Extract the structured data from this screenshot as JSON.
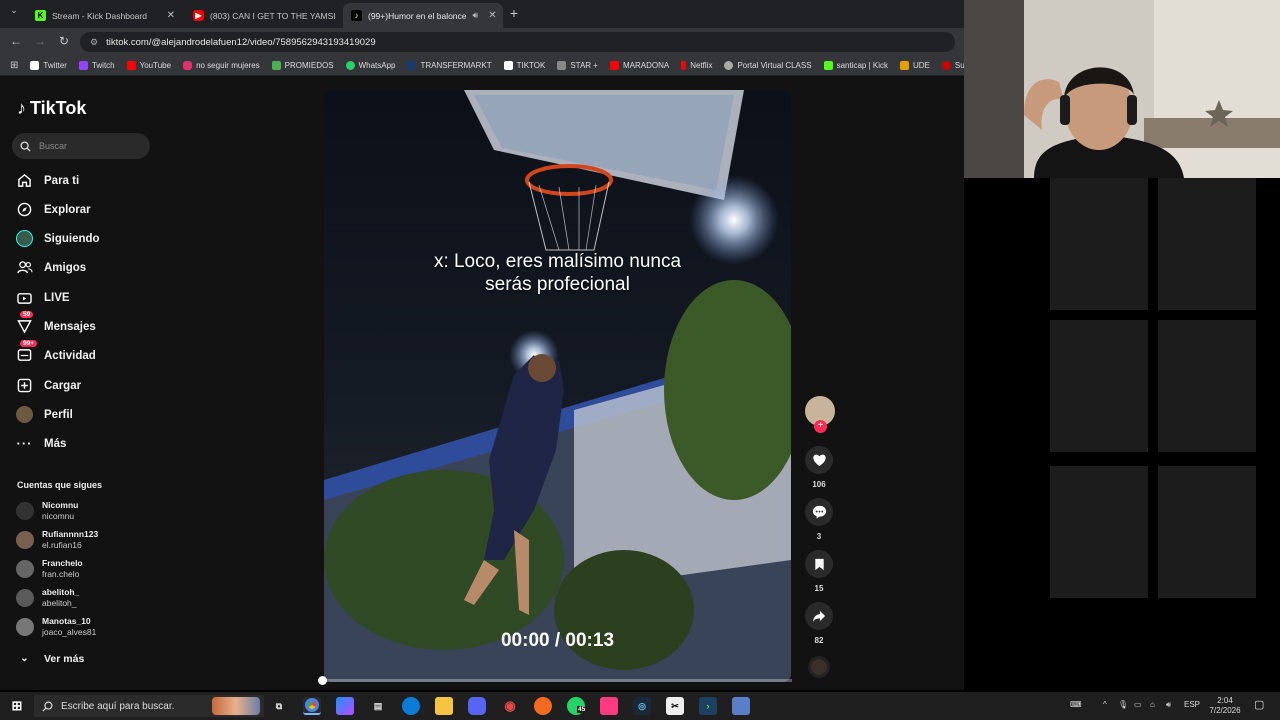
{
  "browser": {
    "tabs": [
      {
        "label": "Stream - Kick Dashboard",
        "icon": "kick-icon"
      },
      {
        "label": "(803) CAN I GET TO THE YAMSI",
        "icon": "youtube-icon"
      },
      {
        "label": "(99+)Humor en el balonce",
        "icon": "tiktok-icon"
      }
    ],
    "new_tab": "+",
    "url": "tiktok.com/@alejandrodelafuen12/video/7589562943193419029",
    "bookmarks": [
      {
        "label": "Twitter",
        "color": "#ffffff"
      },
      {
        "label": "Twitch",
        "color": "#9146ff"
      },
      {
        "label": "YouTube",
        "color": "#ff0000"
      },
      {
        "label": "no seguir mujeres",
        "color": "#e1306c"
      },
      {
        "label": "PROMIEDOS",
        "color": "#4caf50"
      },
      {
        "label": "WhatsApp",
        "color": "#25d366"
      },
      {
        "label": "TRANSFERMARKT",
        "color": "#1a3a6b"
      },
      {
        "label": "TIKTOK",
        "color": "#ffffff"
      },
      {
        "label": "STAR +",
        "color": "#888888"
      },
      {
        "label": "MARADONA",
        "color": "#ff0000"
      },
      {
        "label": "Netflix",
        "color": "#e50914"
      },
      {
        "label": "Portal Virtual CLASS",
        "color": "#aaaaaa"
      },
      {
        "label": "santicap | Kick",
        "color": "#53fc18"
      },
      {
        "label": "UDE",
        "color": "#e6a100"
      },
      {
        "label": "Sup",
        "color": "#cc0000"
      }
    ]
  },
  "tiktok": {
    "logo": "TikTok",
    "search_placeholder": "Buscar",
    "nav": [
      {
        "label": "Para ti"
      },
      {
        "label": "Explorar"
      },
      {
        "label": "Siguiendo"
      },
      {
        "label": "Amigos"
      },
      {
        "label": "LIVE"
      },
      {
        "label": "Mensajes",
        "badge": "59"
      },
      {
        "label": "Actividad",
        "badge": "99+"
      },
      {
        "label": "Cargar"
      },
      {
        "label": "Perfil"
      },
      {
        "label": "Más"
      }
    ],
    "following_title": "Cuentas que sigues",
    "following": [
      {
        "name": "Nicomnu",
        "handle": "nicomnu"
      },
      {
        "name": "Rufiannnn123",
        "handle": "el.rufian16"
      },
      {
        "name": "Franchelo",
        "handle": "fran.chelo"
      },
      {
        "name": "abelitoh_",
        "handle": "abelitoh_"
      },
      {
        "name": "Manotas_10",
        "handle": "joaco_alves81"
      }
    ],
    "see_more": "Ver más",
    "video": {
      "caption_line1": "x: Loco, eres malísimo nunca",
      "caption_line2": "serás profecional",
      "time": "00:00 / 00:13",
      "progress": 0
    },
    "actions": {
      "likes": "106",
      "comments": "3",
      "saves": "15",
      "shares": "82"
    }
  },
  "taskbar": {
    "search_placeholder": "Escribe aquí para buscar.",
    "whatsapp_badge": "45",
    "language": "ESP",
    "time": "2:04",
    "date": "7/2/2026"
  }
}
